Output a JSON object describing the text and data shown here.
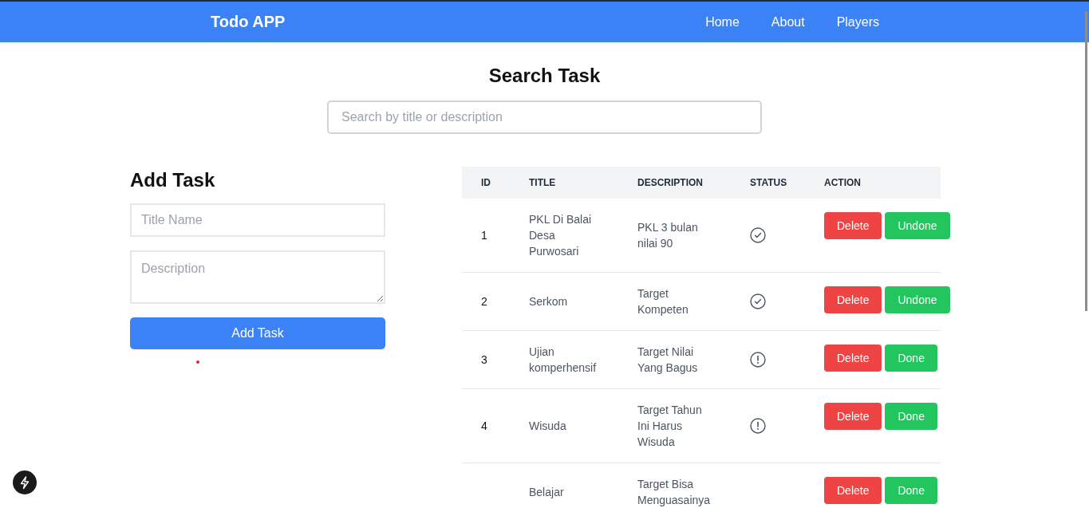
{
  "navbar": {
    "brand": "Todo APP",
    "links": [
      {
        "label": "Home"
      },
      {
        "label": "About"
      },
      {
        "label": "Players"
      }
    ]
  },
  "search": {
    "title": "Search Task",
    "placeholder": "Search by title or description"
  },
  "add_task": {
    "title": "Add Task",
    "title_placeholder": "Title Name",
    "description_placeholder": "Description",
    "button": "Add Task"
  },
  "table": {
    "columns": [
      "ID",
      "TITLE",
      "DESCRIPTION",
      "STATUS",
      "ACTION"
    ],
    "rows": [
      {
        "id": "1",
        "title": "PKL Di Balai Desa Purwosari",
        "description": "PKL 3 bulan nilai 90",
        "done": true,
        "buttons": [
          {
            "kind": "delete",
            "label": "Delete"
          },
          {
            "kind": "toggle",
            "label": "Undone"
          }
        ]
      },
      {
        "id": "2",
        "title": "Serkom",
        "description": "Target Kompeten",
        "done": true,
        "buttons": [
          {
            "kind": "delete",
            "label": "Delete"
          },
          {
            "kind": "toggle",
            "label": "Undone"
          }
        ]
      },
      {
        "id": "3",
        "title": "Ujian komperhensif",
        "description": "Target Nilai Yang Bagus",
        "done": false,
        "buttons": [
          {
            "kind": "delete",
            "label": "Delete"
          },
          {
            "kind": "toggle",
            "label": "Done"
          }
        ]
      },
      {
        "id": "4",
        "title": "Wisuda",
        "description": "Target Tahun Ini Harus Wisuda",
        "done": false,
        "buttons": [
          {
            "kind": "delete",
            "label": "Delete"
          },
          {
            "kind": "toggle",
            "label": "Done"
          }
        ]
      },
      {
        "title": "Belajar",
        "description": "Target Bisa Menguasainya",
        "buttons": [
          {
            "kind": "delete",
            "label": "Delete"
          },
          {
            "kind": "toggle",
            "label": "Done"
          }
        ]
      }
    ]
  }
}
